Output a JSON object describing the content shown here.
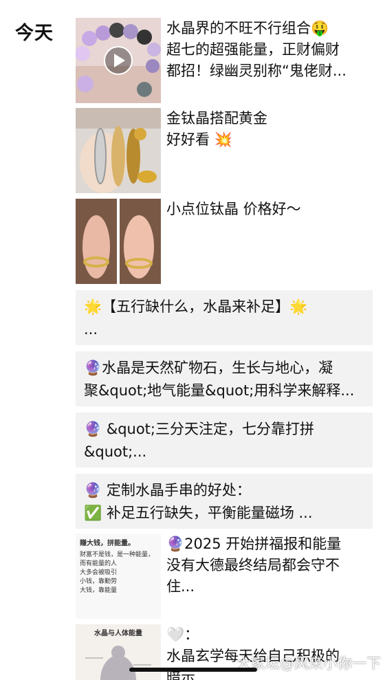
{
  "header": {
    "day_label": "今天"
  },
  "posts": [
    {
      "lines": [
        "水晶界的不旺不行组合🤑",
        "超七的超强能量，正财偏财",
        "都招！绿幽灵别称“鬼佬财..."
      ],
      "thumb": "crystal-bracelet-video"
    },
    {
      "lines": [
        "金钛晶搭配黄金",
        "好好看 💥"
      ],
      "thumb": "gold-rutile-bracelets"
    },
    {
      "lines": [
        "小点位钛晶 价格好～"
      ],
      "thumb": "hands-bracelets"
    }
  ],
  "text_posts": [
    {
      "lines": [
        "🌟【五行缺什么，水晶来补足】🌟",
        "..."
      ]
    },
    {
      "lines": [
        "🔮水晶是天然矿物石，生长与地心，凝",
        "聚&quot;地气能量&quot;用科学来解释..."
      ]
    },
    {
      "lines": [
        "🔮 &quot;三分天注定，七分靠打拼",
        "&quot;..."
      ]
    },
    {
      "lines": [
        "🔮 定制水晶手串的好处：",
        "✅ 补足五行缺失，平衡能量磁场  ..."
      ]
    }
  ],
  "image_posts": [
    {
      "lines": [
        "🔮2025 开始拼福报和能量",
        "没有大德最终结局都会守不",
        "住..."
      ],
      "thumb_title": "赚大钱，拼能量。",
      "thumb_lines": [
        "财富不是钱，是一种能量，",
        "而有能量的人",
        "大多会被吸引",
        "小钱，靠勤劳",
        "大钱，靠能量"
      ]
    },
    {
      "lines": [
        "🤍：",
        "水晶玄学每天给自己积极的",
        "暗示"
      ],
      "thumb_title": "水晶与人体能量"
    }
  ],
  "watermark": "大家坛@风来小你一下"
}
